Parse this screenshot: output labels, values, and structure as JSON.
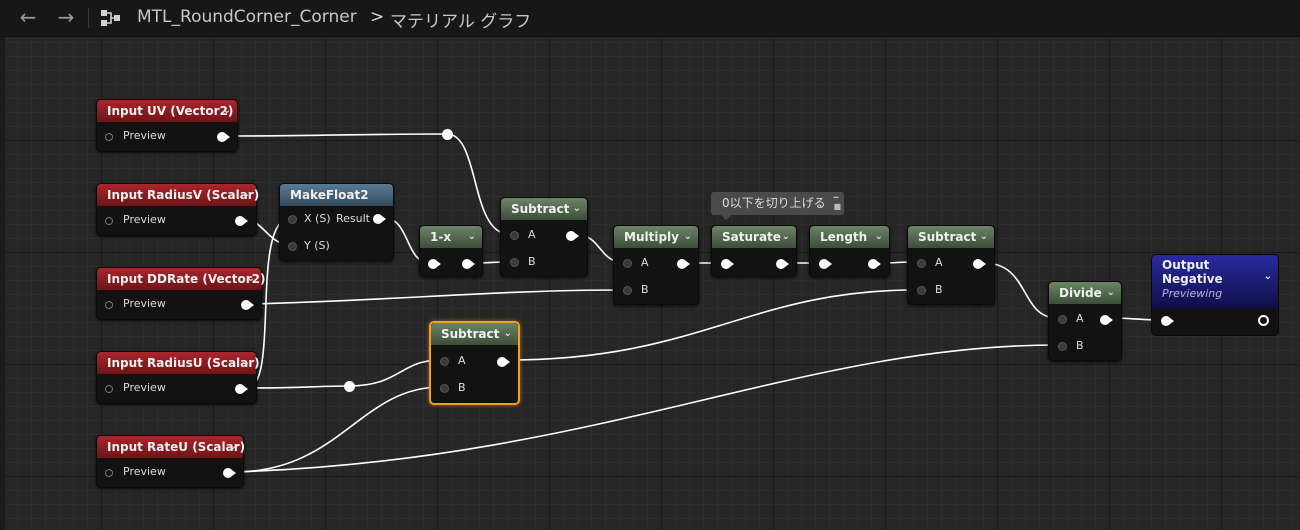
{
  "toolbar": {
    "back_icon": "arrow-left-icon",
    "forward_icon": "arrow-right-icon",
    "graph_icon": "graph-tree-icon",
    "asset_name": "MTL_RoundCorner_Corner",
    "breadcrumb_separator": ">",
    "graph_name": "マテリアル グラフ"
  },
  "comment": {
    "text": "0以下を切り上げる"
  },
  "nodes": {
    "input_uv": {
      "title": "Input UV (Vector2)",
      "pin": "Preview"
    },
    "input_radius_v": {
      "title": "Input RadiusV (Scalar)",
      "pin": "Preview"
    },
    "input_ddrate": {
      "title": "Input DDRate (Vector2)",
      "pin": "Preview"
    },
    "input_radius_u": {
      "title": "Input RadiusU (Scalar)",
      "pin": "Preview"
    },
    "input_rate_u": {
      "title": "Input RateU (Scalar)",
      "pin": "Preview"
    },
    "makefloat2": {
      "title": "MakeFloat2",
      "pin_x": "X (S)",
      "pin_y": "Y (S)",
      "pin_result": "Result"
    },
    "one_minus_x": {
      "title": "1-x"
    },
    "subtract_1": {
      "title": "Subtract",
      "pin_a": "A",
      "pin_b": "B"
    },
    "subtract_selected": {
      "title": "Subtract",
      "pin_a": "A",
      "pin_b": "B"
    },
    "multiply": {
      "title": "Multiply",
      "pin_a": "A",
      "pin_b": "B"
    },
    "saturate": {
      "title": "Saturate"
    },
    "length": {
      "title": "Length"
    },
    "subtract_2": {
      "title": "Subtract",
      "pin_a": "A",
      "pin_b": "B"
    },
    "divide": {
      "title": "Divide",
      "pin_a": "A",
      "pin_b": "B"
    },
    "output_negative": {
      "title": "Output Negative",
      "status": "Previewing"
    }
  },
  "colors": {
    "input_header": "#a8262c",
    "math_header": "#6c8466",
    "makefloat_header": "#597a94",
    "output_header": "#2a2aa0",
    "selection": "#f0a020",
    "wire": "#ffffff"
  }
}
